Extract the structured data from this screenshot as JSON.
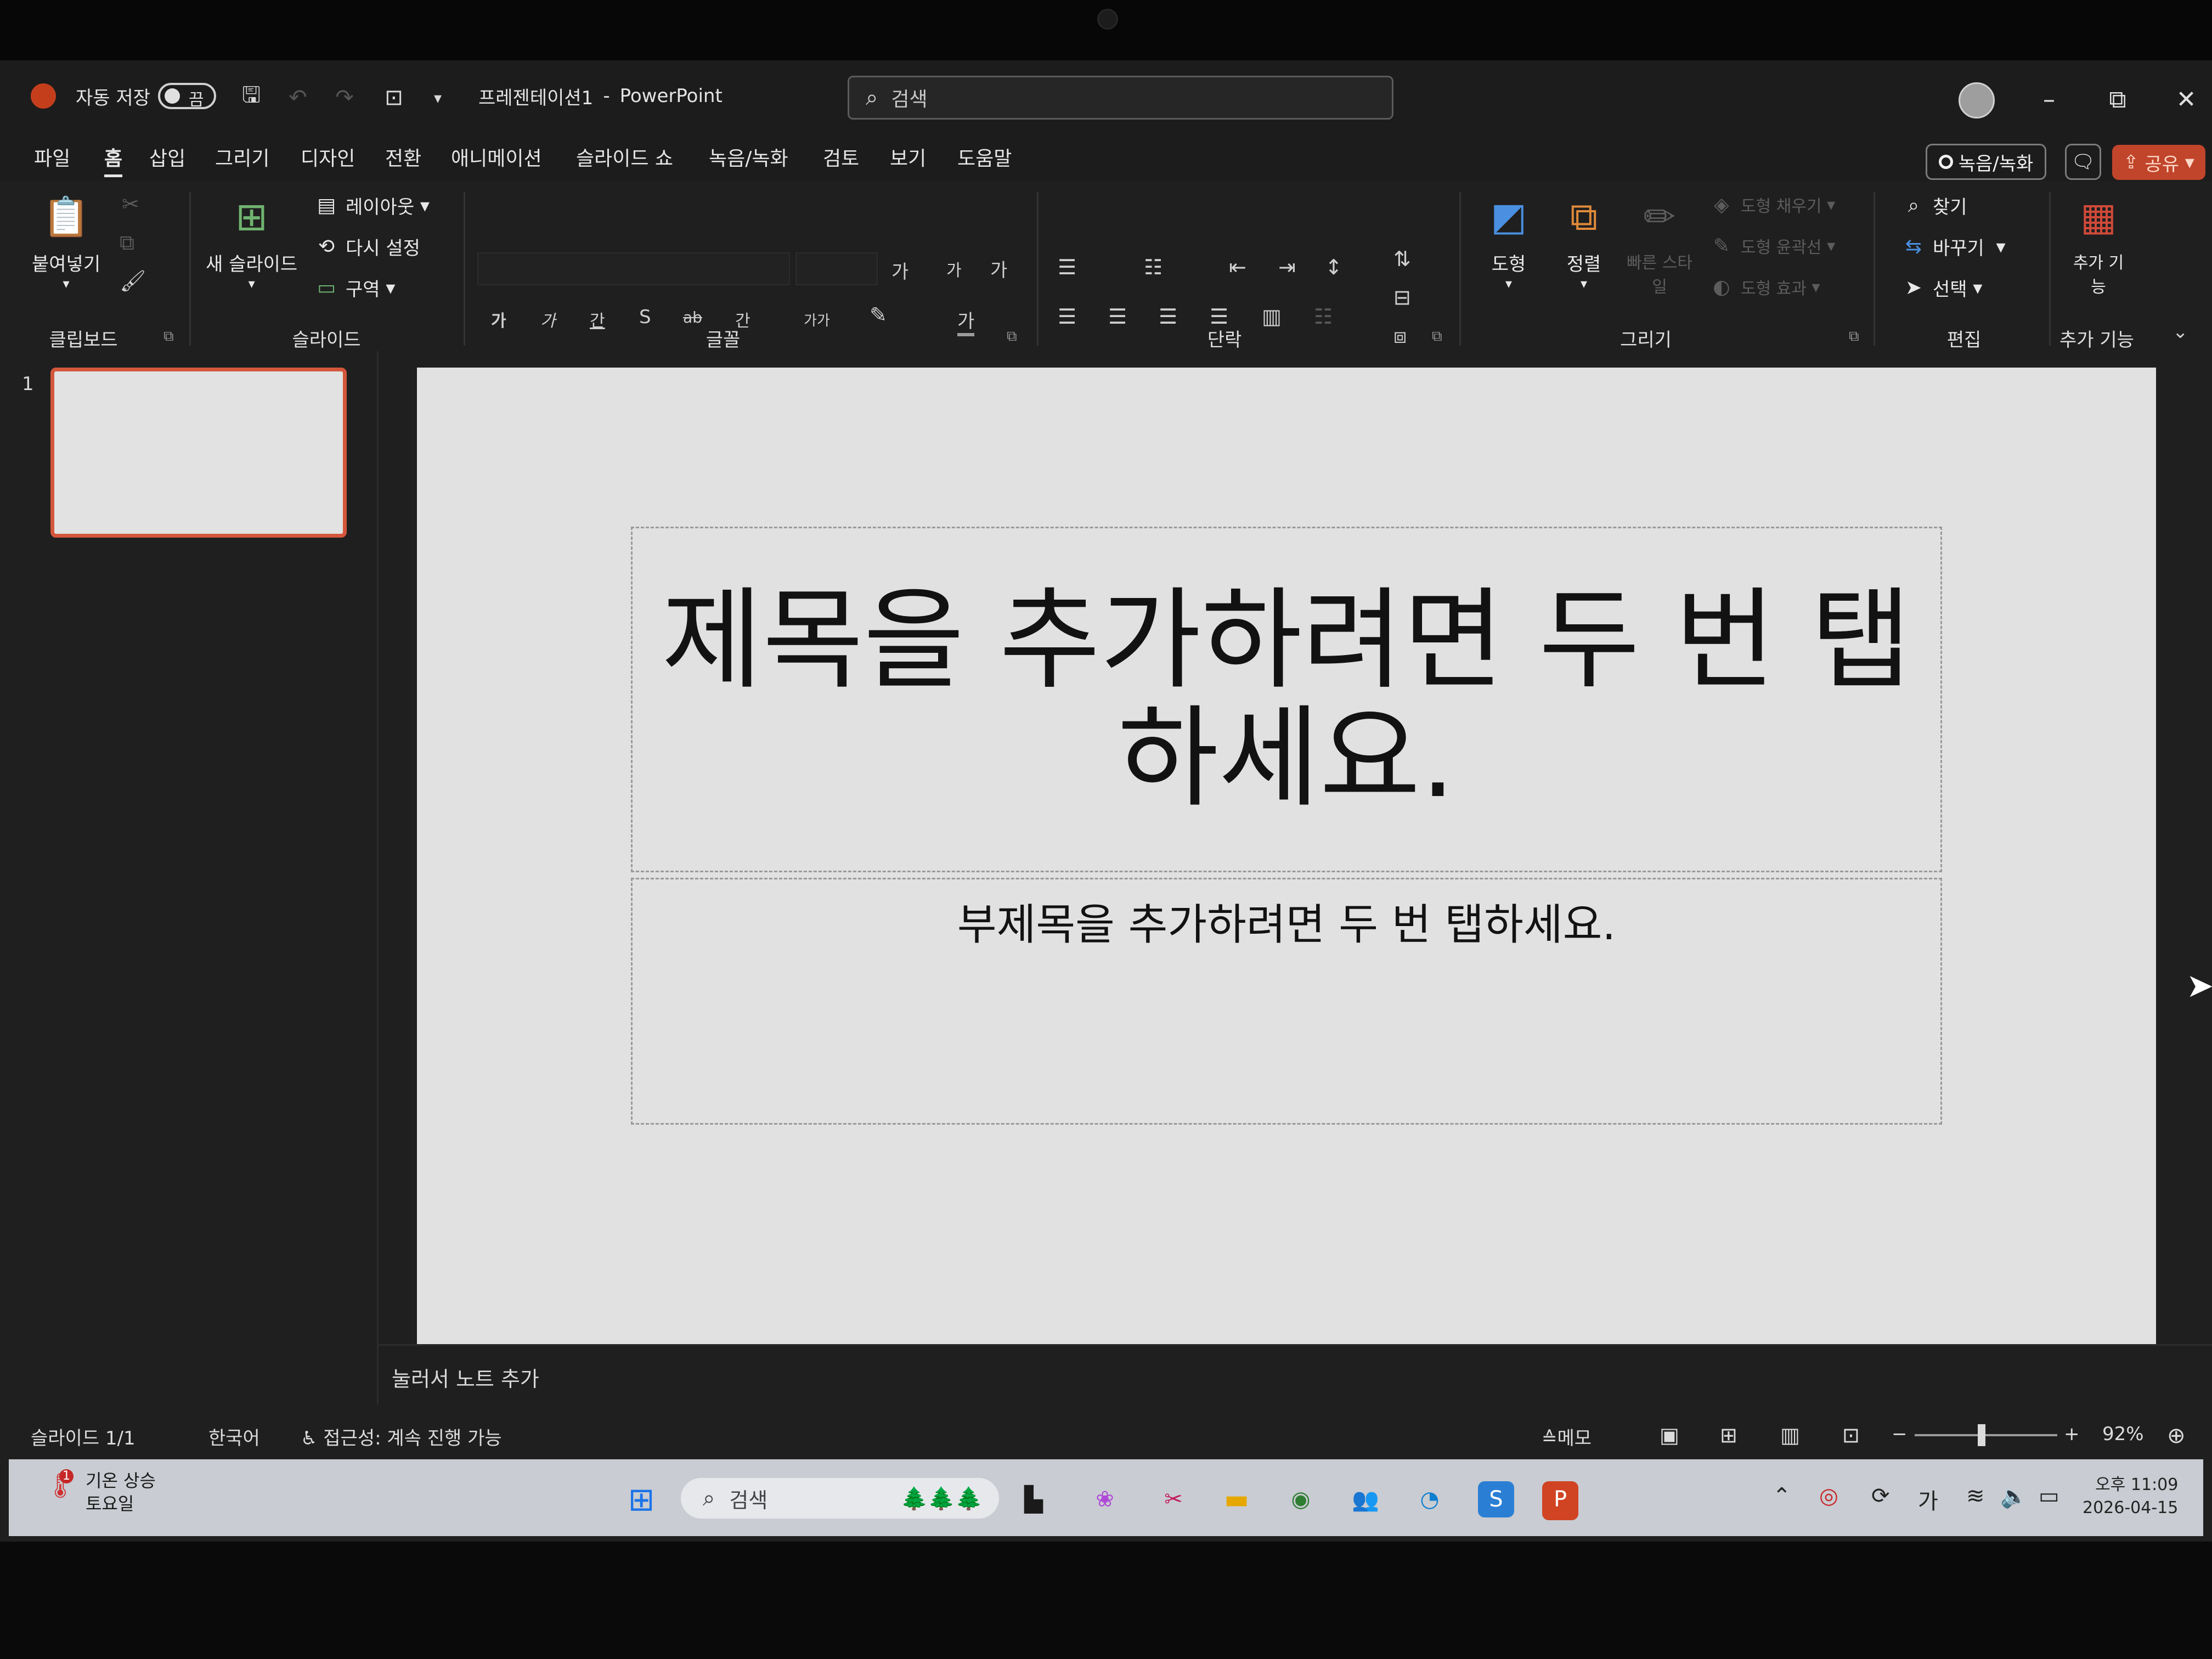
{
  "titlebar": {
    "autosave_label": "자동 저장",
    "autosave_state": "끔",
    "doc_title": "프레젠테이션1",
    "separator": "-",
    "app_name": "PowerPoint",
    "search_placeholder": "검색"
  },
  "tabs": [
    "파일",
    "홈",
    "삽입",
    "그리기",
    "디자인",
    "전환",
    "애니메이션",
    "슬라이드 쇼",
    "녹음/녹화",
    "검토",
    "보기",
    "도움말"
  ],
  "active_tab": "홈",
  "tab_right": {
    "record": "녹음/녹화",
    "share": "공유"
  },
  "ribbon": {
    "clipboard": {
      "paste": "붙여넣기",
      "group": "클립보드"
    },
    "slides": {
      "new_slide": "새 슬라이드",
      "layout": "레이아웃",
      "reset": "다시 설정",
      "section": "구역",
      "group": "슬라이드"
    },
    "font": {
      "group": "글꼴",
      "bold": "가",
      "italic": "가",
      "underline": "간",
      "shadow": "S",
      "strike": "ab",
      "spacing": "간",
      "case": "가가",
      "grow": "가",
      "shrink": "가",
      "clear": "가",
      "color": "가"
    },
    "paragraph": {
      "group": "단락"
    },
    "drawing": {
      "shapes": "도형",
      "arrange": "정렬",
      "quick_styles": "빠른 스타일",
      "fill": "도형 채우기",
      "outline": "도형 윤곽선",
      "effects": "도형 효과",
      "group": "그리기"
    },
    "editing": {
      "find": "찾기",
      "replace": "바꾸기",
      "select": "선택",
      "group": "편집"
    },
    "addins": {
      "addins_btn": "추가 기능",
      "group": "추가 기능"
    }
  },
  "thumbnails": {
    "slide_number": "1"
  },
  "slide": {
    "title_placeholder": "제목을 추가하려면 두 번 탭하세요.",
    "subtitle_placeholder": "부제목을 추가하려면 두 번 탭하세요."
  },
  "notes_placeholder": "눌러서 노트 추가",
  "status": {
    "slide_count": "슬라이드 1/1",
    "language": "한국어",
    "accessibility": "접근성: 계속 진행 가능",
    "notes_btn": "메모",
    "zoom": "92%"
  },
  "taskbar": {
    "weather_line1": "기온 상승",
    "weather_line2": "토요일",
    "weather_badge": "1",
    "search": "검색",
    "ime": "가",
    "time": "오후 11:09",
    "date": "2026-04-15"
  }
}
